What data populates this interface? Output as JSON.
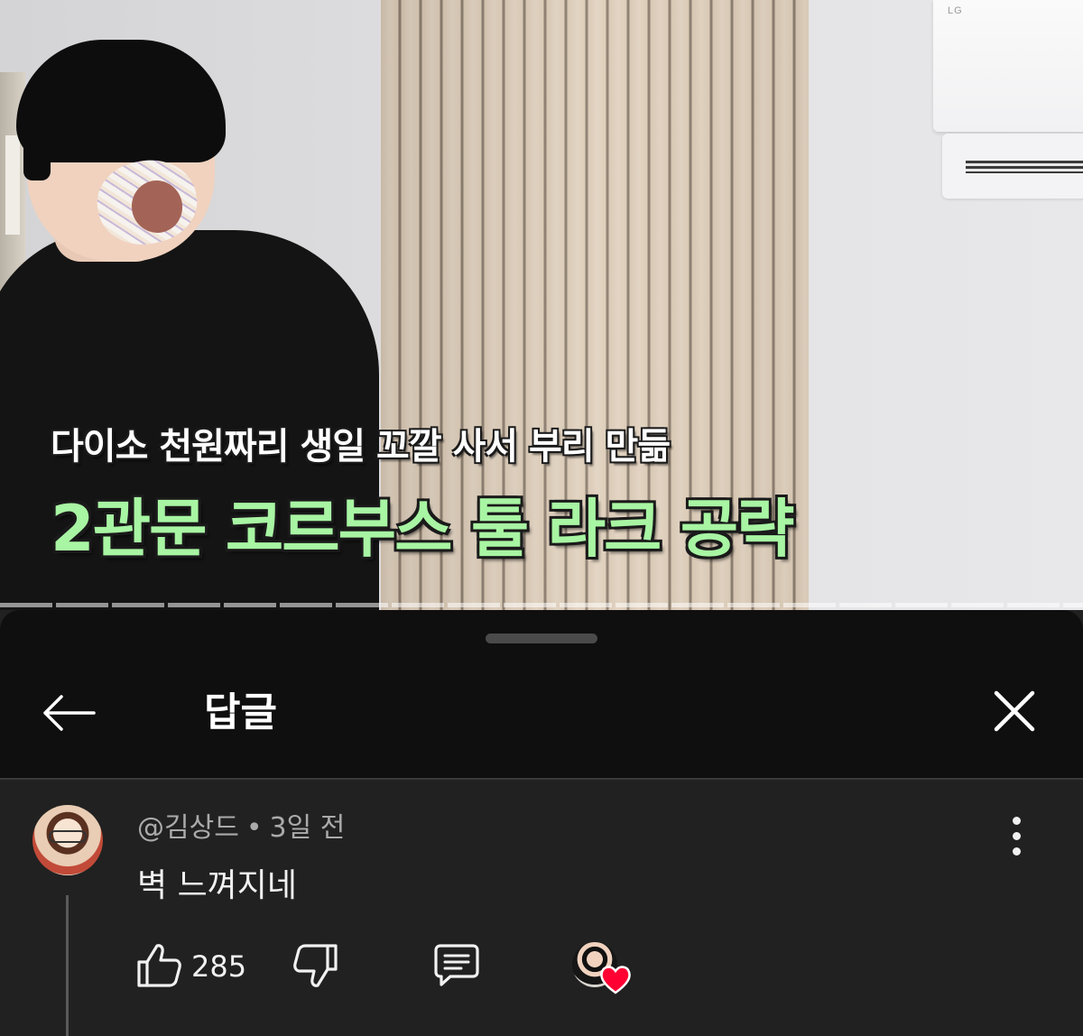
{
  "video": {
    "caption_line1": "다이소 천원짜리 생일 꼬깔 사서 부리 만듦",
    "caption_line2": "2관문 코르부스 툴 라크 공략",
    "ac_brand": "LG",
    "progress_fraction": 0.0
  },
  "panel": {
    "title": "답글",
    "back_icon": "arrow-left-icon",
    "close_icon": "close-icon"
  },
  "comment": {
    "author": "@김상드",
    "separator": "•",
    "time": "3일 전",
    "text": "벽 느껴지네",
    "like_count": "285",
    "icons": {
      "like": "thumb-up-icon",
      "dislike": "thumb-down-icon",
      "reply": "comment-icon",
      "more": "more-vertical-icon",
      "creator_heart": "heart-icon"
    }
  },
  "colors": {
    "caption_green": "#a8f5a3",
    "panel_bg": "#212121",
    "header_bg": "#0f0f0f",
    "heart_red": "#ff0033"
  }
}
